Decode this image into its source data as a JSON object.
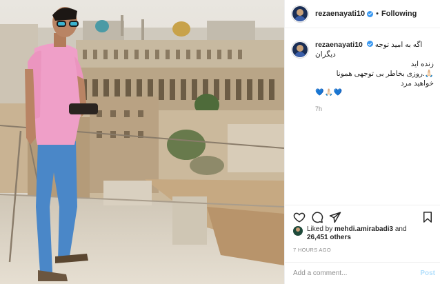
{
  "header": {
    "username": "rezaenayati10",
    "separator": "•",
    "follow_label": "Following"
  },
  "caption": {
    "username": "rezaenayati10",
    "line1": "اگه به امید توجه دیگران",
    "line2": "زنده اید",
    "line3": "🙏🏻.روزی بخاطر بی توجهی همونا خواهید مرد",
    "hearts": "💙🙏🏻💙",
    "time": "7h"
  },
  "likes": {
    "prefix": "Liked by",
    "liker": "mehdi.amirabadi3",
    "joiner": "and",
    "count": "26,451 others"
  },
  "post_time": "7 HOURS AGO",
  "comment": {
    "placeholder": "Add a comment...",
    "post_label": "Post"
  },
  "icons": {
    "like": "heart-icon",
    "comment": "comment-icon",
    "share": "share-icon",
    "save": "bookmark-icon"
  }
}
